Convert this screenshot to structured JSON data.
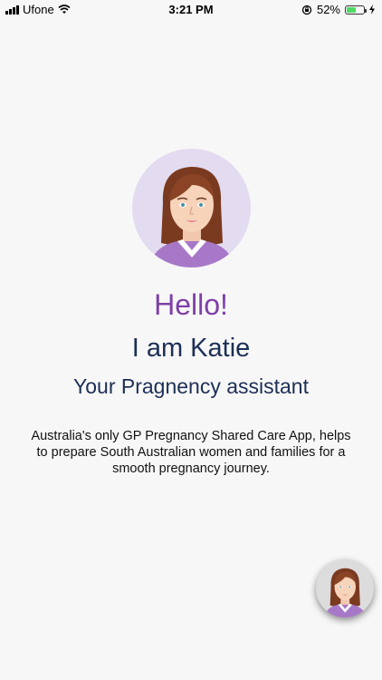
{
  "status_bar": {
    "carrier": "Ufone",
    "time": "3:21 PM",
    "battery_percent": "52%"
  },
  "greeting": "Hello!",
  "intro": "I am Katie",
  "subtitle": "Your Pragnency assistant",
  "description": "Australia's only GP Pregnancy Shared Care App, helps to prepare South Australian women and families for a smooth pregnancy journey.",
  "icons": {
    "wifi": "wifi-icon",
    "rotation_lock": "rotation-lock-icon",
    "battery": "battery-icon",
    "charging": "charging-icon",
    "assistant_avatar": "assistant-avatar",
    "chat_fab": "chat-assistant-button"
  },
  "colors": {
    "greeting": "#7e3fa8",
    "title": "#1c2f55",
    "avatar_bg": "#e3dbef",
    "battery_fill": "#4cd964"
  }
}
